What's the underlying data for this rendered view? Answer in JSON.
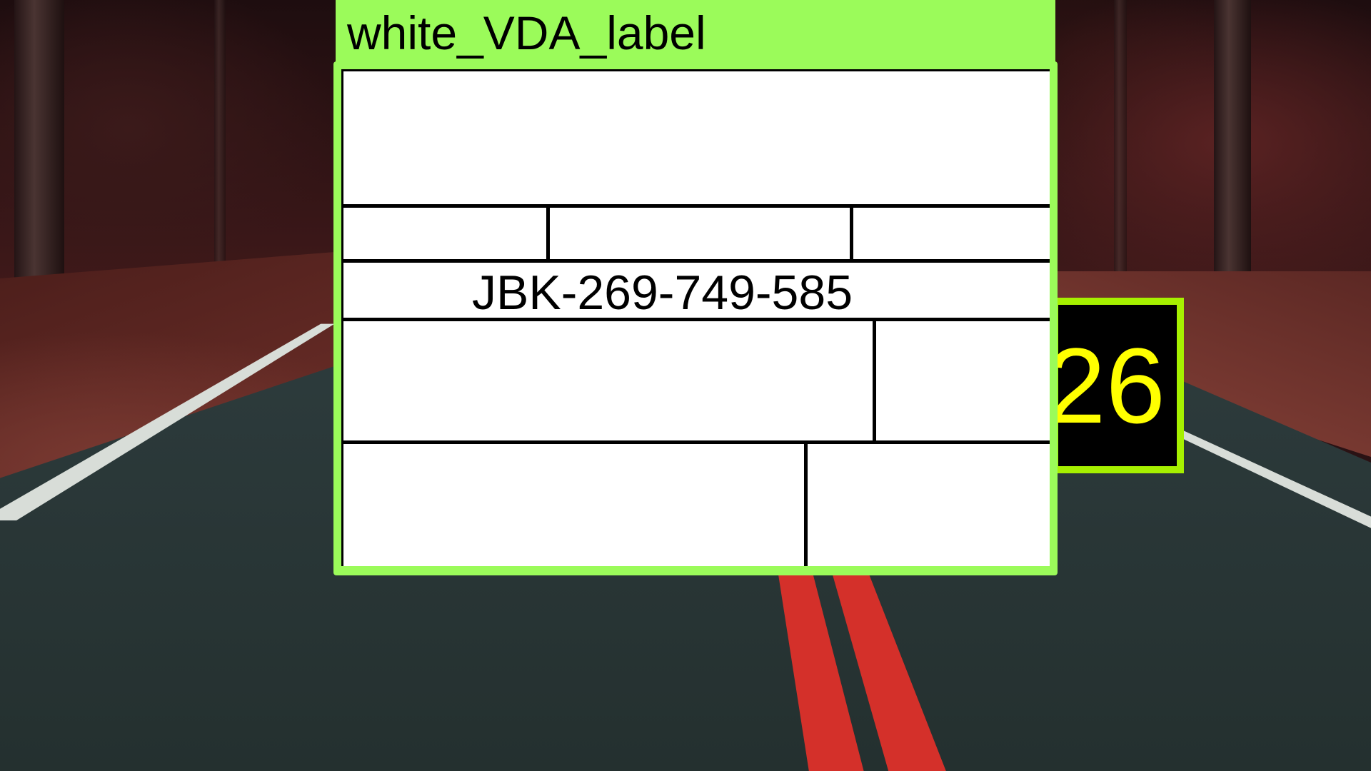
{
  "detection": {
    "class_label": "white_VDA_label",
    "tracking_number": "JBK-269-749-585",
    "score": "26"
  },
  "colors": {
    "box_outline": "#9bfb5a",
    "score_border": "#a6f000",
    "score_text": "#ffff00",
    "label_background": "#ffffff"
  }
}
